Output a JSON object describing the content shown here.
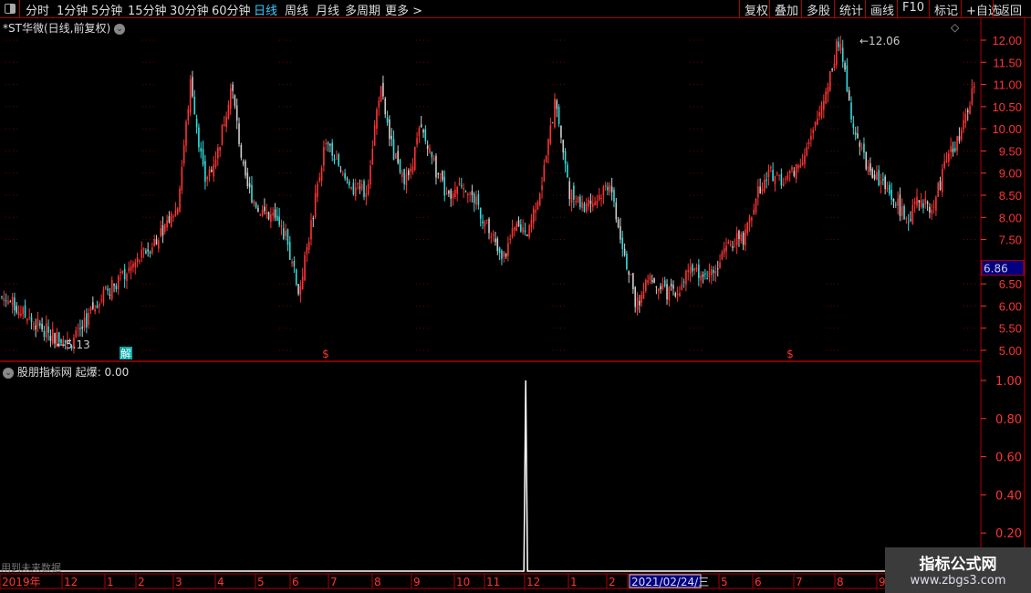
{
  "toolbar": {
    "periods": [
      "分时",
      "1分钟",
      "5分钟",
      "15分钟",
      "30分钟",
      "60分钟",
      "日线",
      "周线",
      "月线",
      "多周期",
      "更多 >"
    ],
    "active_period": "日线",
    "right_buttons": [
      "复权",
      "叠加",
      "多股",
      "统计",
      "画线",
      "F10",
      "标记",
      "+自选",
      "返回"
    ]
  },
  "main": {
    "title": "*ST华微(日线,前复权)",
    "high_label": "12.06",
    "low_label": "5.13",
    "cursor_price": "6.86",
    "markers": [
      {
        "text": "解",
        "color": "#0aa"
      },
      {
        "text": "$",
        "color": "#f33"
      },
      {
        "text": "$",
        "color": "#f33"
      }
    ]
  },
  "indicator": {
    "title": "股朋指标网",
    "name": "起爆",
    "value": ": 0.00",
    "footer": "用到未来数据"
  },
  "time_axis": {
    "labels": [
      "2019年",
      "12",
      "1",
      "2",
      "3",
      "4",
      "5",
      "6",
      "7",
      "8",
      "9",
      "10",
      "11",
      "12",
      "1",
      "2",
      "2021/02/24/三",
      "5",
      "6",
      "7",
      "8",
      "9"
    ]
  },
  "watermark": {
    "line1": "指标公式网",
    "line2": "www.zbgs3.com"
  },
  "colors": {
    "up": "#ff3333",
    "down": "#33dddd",
    "neutral": "#cccccc",
    "axis": "#ff3333",
    "frame": "#b00000",
    "cursor_bg": "#000080"
  },
  "chart_data": [
    {
      "type": "candlestick",
      "title": "*ST华微(日线,前复权)",
      "y_ticks": [
        "12.00",
        "11.50",
        "11.00",
        "10.50",
        "10.00",
        "9.50",
        "9.00",
        "8.50",
        "8.00",
        "7.50",
        "6.50",
        "6.00",
        "5.50",
        "5.00"
      ],
      "ylim": [
        4.9,
        12.1
      ],
      "close_sampled": [
        6.2,
        6.0,
        5.7,
        5.5,
        5.3,
        5.13,
        5.5,
        6.1,
        6.4,
        6.7,
        7.0,
        7.35,
        7.8,
        8.2,
        11.1,
        8.8,
        9.5,
        11.0,
        8.8,
        8.2,
        8.0,
        7.6,
        6.3,
        8.0,
        9.8,
        9.0,
        8.6,
        8.6,
        10.95,
        9.4,
        8.8,
        10.0,
        9.2,
        8.4,
        8.8,
        8.4,
        7.75,
        7.0,
        7.75,
        7.75,
        8.8,
        10.65,
        8.6,
        8.2,
        8.4,
        8.8,
        7.35,
        6.0,
        6.7,
        6.3,
        6.3,
        6.9,
        6.7,
        6.9,
        7.45,
        7.55,
        8.6,
        9.0,
        8.8,
        9.2,
        9.8,
        10.85,
        12.06,
        10.2,
        9.2,
        8.8,
        8.4,
        8.0,
        8.4,
        8.2,
        9.4,
        9.8,
        10.95
      ]
    },
    {
      "type": "line",
      "title": "起爆",
      "y_ticks": [
        "1.00",
        "0.80",
        "0.60",
        "0.40",
        "0.20"
      ],
      "ylim": [
        0,
        1.05
      ],
      "nonzero_points": [
        {
          "position_fraction": 0.536,
          "value": 1.0
        }
      ]
    }
  ]
}
